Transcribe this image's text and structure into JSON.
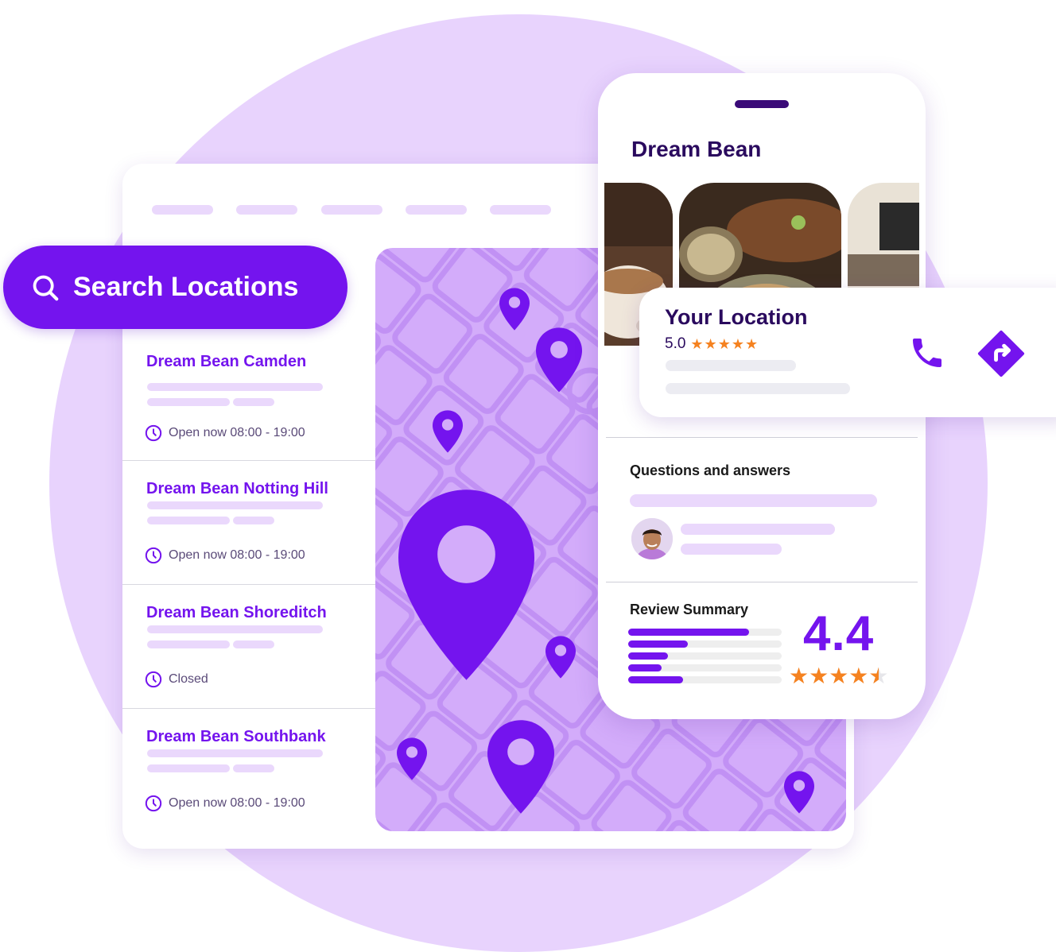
{
  "search": {
    "label": "Search Locations"
  },
  "locations": [
    {
      "name": "Dream Bean Camden",
      "status": "Open now 08:00 - 19:00"
    },
    {
      "name": "Dream Bean Notting Hill",
      "status": "Open now 08:00 - 19:00"
    },
    {
      "name": "Dream Bean Shoreditch",
      "status": "Closed"
    },
    {
      "name": "Dream Bean Southbank",
      "status": "Open now 08:00 - 19:00"
    }
  ],
  "phone": {
    "title": "Dream Bean",
    "qa_title": "Questions and answers",
    "review_title": "Review Summary",
    "rating": "4.4",
    "rating_stars": "★★★★",
    "rating_value": 4.4,
    "review_distribution": [
      0.79,
      0.39,
      0.26,
      0.22,
      0.36
    ]
  },
  "your_location": {
    "title": "Your Location",
    "rating": "5.0",
    "stars": "★★★★★"
  },
  "icons": {
    "search": "search-icon",
    "clock": "clock-icon",
    "phone": "phone-icon",
    "directions": "directions-icon",
    "map_pin": "map-pin-icon"
  },
  "colors": {
    "brand": "#7414ee",
    "dark": "#2a0a5e",
    "lavender": "#e8d3fd",
    "map": "#d3acfa",
    "star": "#f58220"
  }
}
